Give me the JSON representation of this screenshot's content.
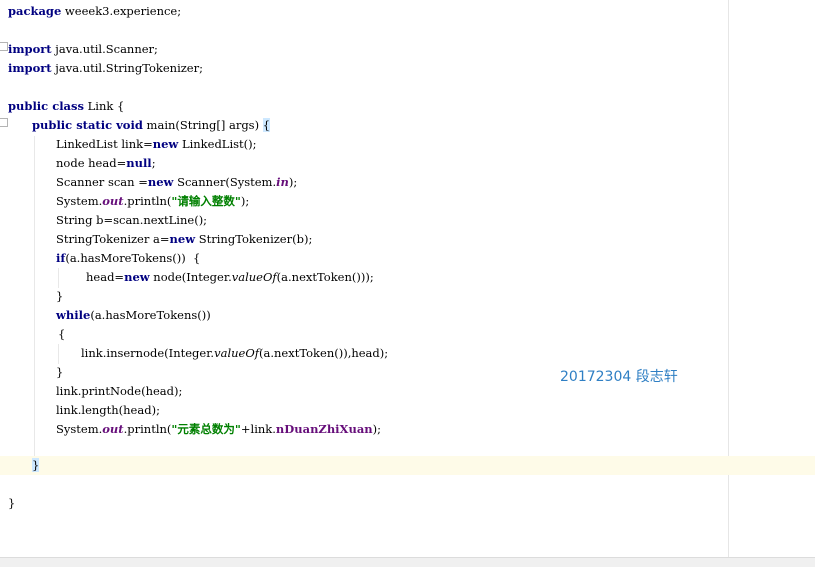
{
  "editor": {
    "lines": {
      "package_kw": "package",
      "package_name": " weeek3.experience;",
      "import1_kw": "import",
      "import1_name": " java.util.Scanner;",
      "import2_kw": "import",
      "import2_name": " java.util.StringTokenizer;",
      "class_kw1": "public",
      "class_kw2": " class",
      "class_name": " Link {",
      "main_kw1": "public",
      "main_kw2": " static",
      "main_kw3": " void",
      "main_sig": " main(String[] args) ",
      "main_brace": "{",
      "l7": "LinkedList link=",
      "l7_kw": "new",
      "l7_rest": " LinkedList();",
      "l8": "node head=",
      "l8_kw": "null",
      "l8_rest": ";",
      "l9": "Scanner scan =",
      "l9_kw": "new",
      "l9_mid": " Scanner(System.",
      "l9_field": "in",
      "l9_rest": ");",
      "l10_a": "System.",
      "l10_field": "out",
      "l10_b": ".println(",
      "l10_str": "\"请输入整数\"",
      "l10_rest": ");",
      "l11": "String b=scan.nextLine();",
      "l12": "StringTokenizer a=",
      "l12_kw": "new",
      "l12_rest": " StringTokenizer(b);",
      "l13_kw": "if",
      "l13_rest": "(a.hasMoreTokens())  {",
      "l14": "head=",
      "l14_kw": "new",
      "l14_mid": " node(Integer.",
      "l14_method": "valueOf",
      "l14_rest": "(a.nextToken()));",
      "l15": "}",
      "l16_kw": "while",
      "l16_rest": "(a.hasMoreTokens())",
      "l17": "{",
      "l18_a": "link.insernode(Integer.",
      "l18_method": "valueOf",
      "l18_rest": "(a.nextToken()),head);",
      "l19": "}",
      "l20": "link.printNode(head);",
      "l21": "link.length(head);",
      "l22_a": "System.",
      "l22_field": "out",
      "l22_b": ".println(",
      "l22_str": "\"元素总数为\"",
      "l22_c": "+link.",
      "l22_field2": "nDuanZhiXuan",
      "l22_rest": ");",
      "l24": "}",
      "l26": "}"
    },
    "annotation": "20172304  段志轩"
  },
  "colors": {
    "keyword": "#000080",
    "string": "#008000",
    "field": "#660e7a",
    "annotation": "#2f7fc4",
    "current_line": "#fefbe8"
  }
}
